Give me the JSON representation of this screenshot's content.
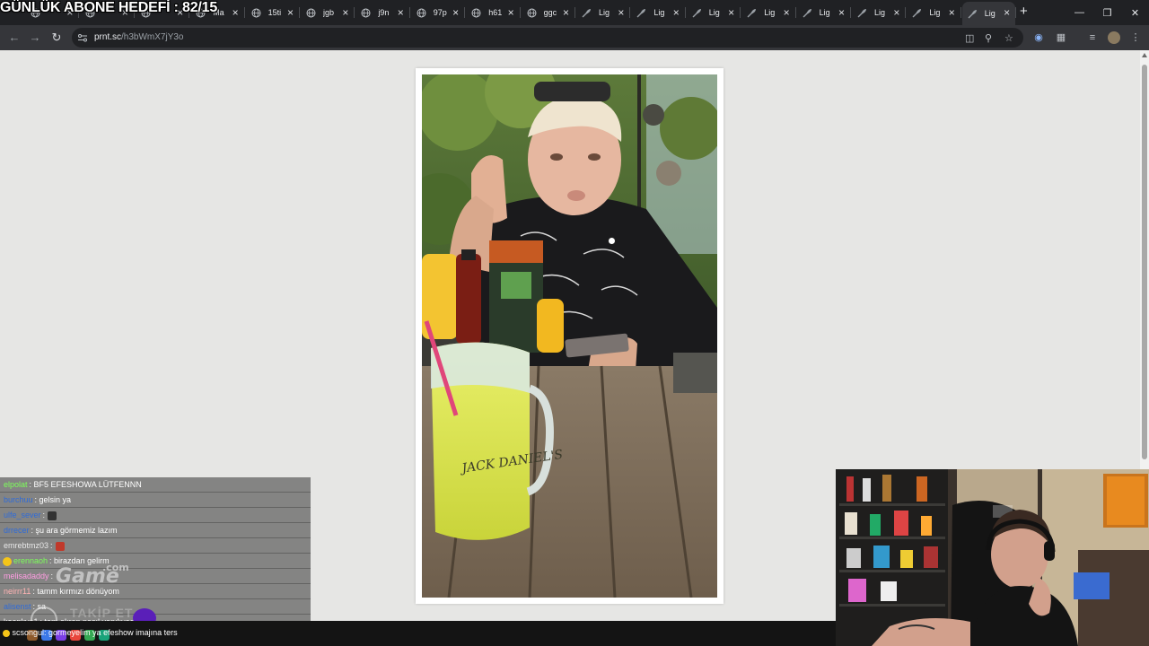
{
  "overlay": {
    "goal_text": "GÜNLÜK ABONE HEDEFİ : 82/15"
  },
  "browser": {
    "tabs": [
      {
        "title": "",
        "icon": "globe-icon"
      },
      {
        "title": "",
        "icon": "globe-icon"
      },
      {
        "title": "",
        "icon": "globe-icon"
      },
      {
        "title": "Ma",
        "icon": "globe-icon"
      },
      {
        "title": "15ti",
        "icon": "globe-icon"
      },
      {
        "title": "jgb",
        "icon": "globe-icon"
      },
      {
        "title": "j9n",
        "icon": "globe-icon"
      },
      {
        "title": "97p",
        "icon": "globe-icon"
      },
      {
        "title": "h61",
        "icon": "globe-icon"
      },
      {
        "title": "ggc",
        "icon": "globe-icon"
      },
      {
        "title": "Lig",
        "icon": "feather-icon"
      },
      {
        "title": "Lig",
        "icon": "feather-icon"
      },
      {
        "title": "Lig",
        "icon": "feather-icon"
      },
      {
        "title": "Lig",
        "icon": "feather-icon"
      },
      {
        "title": "Lig",
        "icon": "feather-icon"
      },
      {
        "title": "Lig",
        "icon": "feather-icon"
      },
      {
        "title": "Lig",
        "icon": "feather-icon"
      },
      {
        "title": "Lig",
        "icon": "feather-icon"
      }
    ],
    "active_tab_index": 17,
    "url_host": "prnt.sc",
    "url_path": "/h3bWmX7jY3o"
  },
  "chat": {
    "messages": [
      {
        "user": "elpolat",
        "text": ": BF5 EFESHOWA LÜTFENNN",
        "color": "#7dff5a"
      },
      {
        "user": "burchuu",
        "text": ": gelsin ya",
        "color": "#2f6bd8"
      },
      {
        "user": "ulfe_sever",
        "text": ":",
        "color": "#2f6bd8",
        "emote": true
      },
      {
        "user": "drrecer",
        "text": ": şu ara görmemiz lazım",
        "color": "#2f6bd8"
      },
      {
        "user": "emrebtmz03",
        "text": ":",
        "color": "#e8e8e8",
        "emote": true
      },
      {
        "user": "erennaoh",
        "text": ": birazdan gelirm",
        "color": "#7dff5a",
        "badge": true
      },
      {
        "user": "melisadaddy",
        "text": ":",
        "color": "#ff9de2"
      },
      {
        "user": "neirrr11",
        "text": ": tamm kırmızı dönüyom",
        "color": "#ffb3b3"
      },
      {
        "user": "alisenst",
        "text": ": sa",
        "color": "#2f6bd8"
      },
      {
        "user": "kaankya1",
        "text": ": tam ekran nasıl yapılıyoooo",
        "color": "#ffffff"
      }
    ],
    "bottom_message": {
      "user": "scsongul",
      "text": ": gormeyelim ya efeshow imajına ters"
    }
  },
  "branding": {
    "partner_logo": "Game",
    "partner_tld": ".com",
    "follow_label": "TAKİP ET"
  }
}
